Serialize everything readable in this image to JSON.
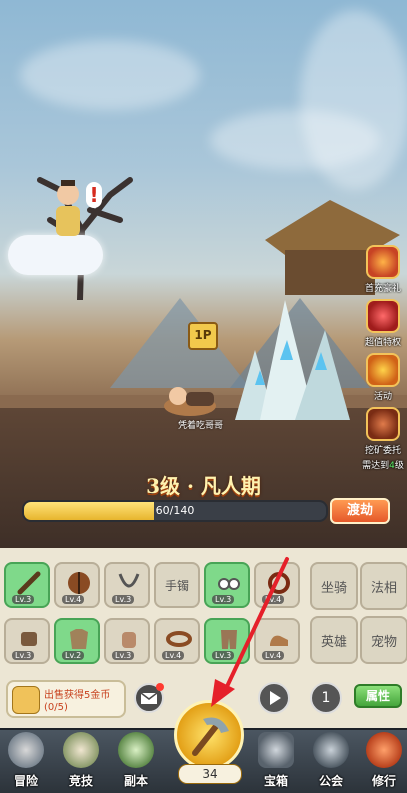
{
  "scene": {
    "stage_title": "3级 · 凡人期",
    "player_tag": "1P",
    "player_name": "凭着吃哥哥"
  },
  "side_menu": [
    {
      "label": "首充豪礼"
    },
    {
      "label": "超值特权"
    },
    {
      "label": "活动"
    },
    {
      "label": "挖矿委托",
      "sub_prefix": "需达到",
      "sub_level": "4",
      "sub_suffix": "级"
    }
  ],
  "progress": {
    "current": 60,
    "max": 140,
    "fraction": 0.43,
    "text": "60/140",
    "action_label": "渡劫"
  },
  "equipment": {
    "row1": [
      {
        "name": "sword",
        "level": "Lv.3",
        "highlight": true
      },
      {
        "name": "shield",
        "level": "Lv.4",
        "highlight": false
      },
      {
        "name": "necklace",
        "level": "Lv.3",
        "highlight": false
      },
      {
        "name": "bracelet-label",
        "label": "手镯"
      },
      {
        "name": "earrings",
        "level": "Lv.3",
        "highlight": true
      },
      {
        "name": "ring",
        "level": "Lv.4",
        "highlight": false
      }
    ],
    "row2": [
      {
        "name": "bracer",
        "level": "Lv.3",
        "highlight": false
      },
      {
        "name": "armor",
        "level": "Lv.2",
        "highlight": true
      },
      {
        "name": "gloves",
        "level": "Lv.3",
        "highlight": false
      },
      {
        "name": "belt",
        "level": "Lv.4",
        "highlight": false
      },
      {
        "name": "pants",
        "level": "Lv.3",
        "highlight": true
      },
      {
        "name": "boots",
        "level": "Lv.4",
        "highlight": false
      }
    ]
  },
  "side_buttons": {
    "mount": "坐骑",
    "dharma": "法相",
    "hero": "英雄",
    "pet": "宠物"
  },
  "sell": {
    "text": "出售获得5金币",
    "count": "(0/5)"
  },
  "speed": "1",
  "attr_label": "属性",
  "center_count": "34",
  "nav": [
    {
      "label": "冒险"
    },
    {
      "label": "竞技"
    },
    {
      "label": "副本"
    },
    {
      "label": "宝箱"
    },
    {
      "label": "公会"
    },
    {
      "label": "修行"
    }
  ],
  "colors": {
    "slot_highlight": "#7fd98a",
    "progress_fill": "#e7b52e",
    "action_button": "#e5582a",
    "attr_button": "#44a53b",
    "annotation_arrow": "#e5202a"
  }
}
